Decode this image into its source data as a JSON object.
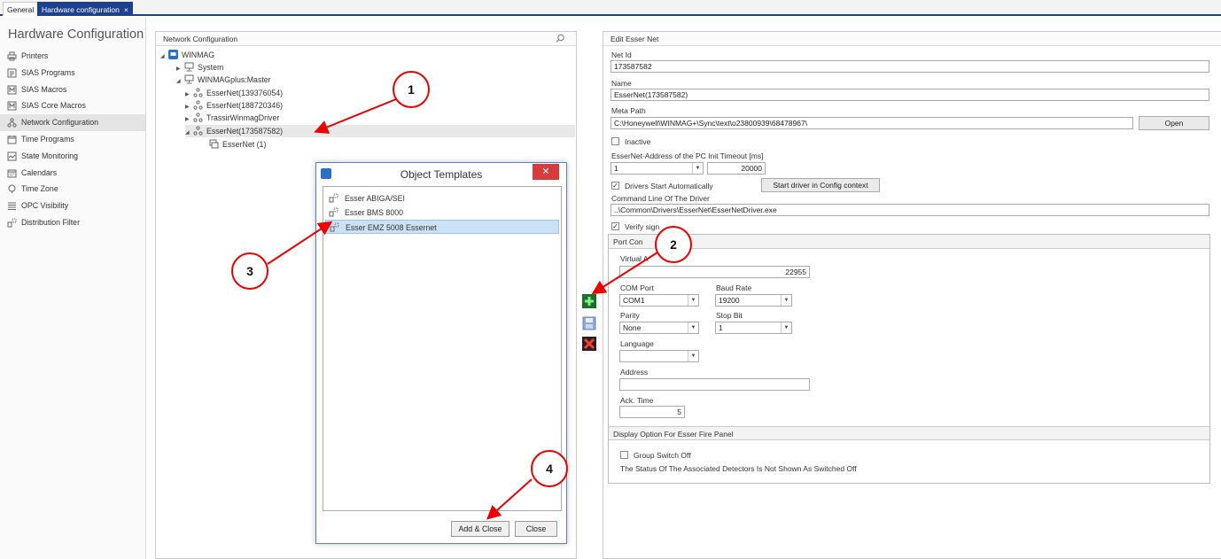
{
  "tabs": [
    {
      "label": "General"
    },
    {
      "label": "Hardware configuration",
      "close": "×"
    }
  ],
  "leftnav": {
    "title": "Hardware Configuration",
    "items": [
      {
        "label": "Printers",
        "icon": "printer-icon"
      },
      {
        "label": "SIAS Programs",
        "icon": "program-icon"
      },
      {
        "label": "SIAS Macros",
        "icon": "macro-icon"
      },
      {
        "label": "SIAS Core Macros",
        "icon": "core-macro-icon"
      },
      {
        "label": "Network Configuration",
        "icon": "network-icon"
      },
      {
        "label": "Time Programs",
        "icon": "calendar-icon"
      },
      {
        "label": "State Monitoring",
        "icon": "monitor-icon"
      },
      {
        "label": "Calendars",
        "icon": "calendar-icon"
      },
      {
        "label": "Time Zone",
        "icon": "pin-icon"
      },
      {
        "label": "OPC Visibility",
        "icon": "list-icon"
      },
      {
        "label": "Distribution Filter",
        "icon": "filter-icon"
      }
    ]
  },
  "network": {
    "header": "Network Configuration",
    "tree": [
      {
        "label": "WINMAG",
        "expander": "◢"
      },
      {
        "label": "System",
        "expander": "▶"
      },
      {
        "label": "WINMAGplus:Master",
        "expander": "◢"
      },
      {
        "label": "EsserNet(139376054)",
        "expander": "▶"
      },
      {
        "label": "EsserNet(188720346)",
        "expander": "▶"
      },
      {
        "label": "TrassirWinmagDriver",
        "expander": "▶"
      },
      {
        "label": "EsserNet(173587582)",
        "expander": "◢"
      },
      {
        "label": "EsserNet  (1)",
        "expander": ""
      }
    ]
  },
  "dialog": {
    "title": "Object Templates",
    "close": "✕",
    "items": [
      {
        "label": "Esser ABIGA/SEI"
      },
      {
        "label": "Esser BMS 8000"
      },
      {
        "label": "Esser EMZ 5008 Essernet"
      }
    ],
    "add_close": "Add & Close",
    "close_btn": "Close"
  },
  "edit": {
    "header": "Edit Esser Net",
    "net_id_label": "Net Id",
    "net_id": "173587582",
    "name_label": "Name",
    "name": "EsserNet(173587582)",
    "meta_path_label": "Meta Path",
    "meta_path": "C:\\Honeywell\\WINMAG+\\Sync\\text\\o23800939\\68478967\\",
    "open": "Open",
    "inactive": "Inactive",
    "addr_label": "EsserNet-Address of the PC Init Timeout [ms]",
    "addr_value": "1",
    "timeout": "20000",
    "drivers_auto": "Drivers Start Automatically",
    "start_driver": "Start driver in Config context",
    "cmdline_label": "Command Line Of The Driver",
    "cmdline": "..\\Common\\Drivers\\EsserNet\\EsserNetDriver.exe",
    "verify": "Verify sign",
    "port_group": "Port Con",
    "virtual_label": "Virtual A",
    "virtual_value": "22955",
    "com_label": "COM Port",
    "com_value": "COM1",
    "baud_label": "Baud Rate",
    "baud_value": "19200",
    "parity_label": "Parity",
    "parity_value": "None",
    "stop_label": "Stop Bit",
    "stop_value": "1",
    "language_label": "Language",
    "address_label": "Address",
    "ack_label": "Ack. Time",
    "ack_value": "5",
    "display_group": "Display Option For Esser Fire Panel",
    "group_switch": "Group Switch Off",
    "status_text": "The Status Of The Associated Detectors Is Not Shown As Switched Off"
  },
  "callouts": [
    "1",
    "2",
    "3",
    "4"
  ],
  "colors": {
    "accent": "#1f3f8f",
    "callout": "#e00000",
    "selection": "#cde1f5"
  }
}
